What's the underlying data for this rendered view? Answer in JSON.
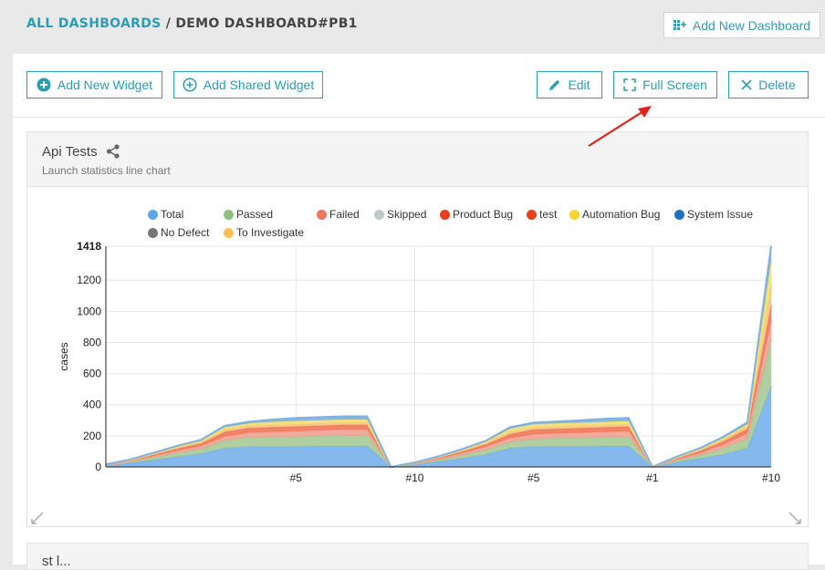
{
  "breadcrumb": {
    "all": "ALL DASHBOARDS",
    "sep": "/",
    "current": "DEMO DASHBOARD#PB1"
  },
  "header": {
    "add_dashboard": "Add New Dashboard"
  },
  "toolbar": {
    "add_widget": "Add New Widget",
    "add_shared": "Add Shared Widget",
    "edit": "Edit",
    "full_screen": "Full Screen",
    "delete": "Delete"
  },
  "widget": {
    "title": "Api Tests",
    "subtitle": "Launch statistics line chart"
  },
  "widget2": {
    "title": "st l..."
  },
  "colors": {
    "accent": "#2d9cb4",
    "arrow": "#e3221c"
  },
  "chart_data": {
    "type": "area",
    "ylabel": "cases",
    "y_max_label": "1418",
    "y_ticks": [
      "0",
      "200",
      "400",
      "600",
      "800",
      "1000",
      "1200"
    ],
    "x_ticks": [
      {
        "i": 8,
        "label": "#5"
      },
      {
        "i": 13,
        "label": "#10"
      },
      {
        "i": 18,
        "label": "#5"
      },
      {
        "i": 23,
        "label": "#1"
      },
      {
        "i": 28,
        "label": "#10"
      }
    ],
    "ylim": [
      0,
      1418
    ],
    "n_points": 29,
    "legend": [
      {
        "name": "Total",
        "color": "#5da5e8"
      },
      {
        "name": "Passed",
        "color": "#8fbf7f"
      },
      {
        "name": "Failed",
        "color": "#ee7559"
      },
      {
        "name": "Skipped",
        "color": "#c0c7ca"
      },
      {
        "name": "Product Bug",
        "color": "#e8401c"
      },
      {
        "name": "test",
        "color": "#e8401c"
      },
      {
        "name": "Automation Bug",
        "color": "#f5d42c"
      },
      {
        "name": "System Issue",
        "color": "#1f72c0"
      },
      {
        "name": "No Defect",
        "color": "#777777"
      },
      {
        "name": "To Investigate",
        "color": "#fcbf57"
      }
    ],
    "stack_colors": [
      "#7bb3ec",
      "#a9cb98",
      "#f0a394",
      "#f07a5a",
      "#f5c888",
      "#f2df72",
      "#7fb2de",
      "#f8c07a"
    ],
    "series": [
      {
        "name": "Passed-area",
        "values": [
          8,
          25,
          45,
          65,
          85,
          120,
          130,
          130,
          130,
          135,
          135,
          135,
          0,
          15,
          35,
          55,
          80,
          120,
          130,
          130,
          130,
          135,
          135,
          0,
          30,
          55,
          80,
          120,
          520
        ]
      },
      {
        "name": "Failed-area",
        "values": [
          2,
          8,
          15,
          25,
          30,
          50,
          60,
          65,
          65,
          65,
          70,
          70,
          0,
          5,
          10,
          20,
          30,
          40,
          50,
          55,
          55,
          55,
          60,
          0,
          10,
          20,
          40,
          60,
          300
        ]
      },
      {
        "name": "Defect-area",
        "values": [
          2,
          5,
          10,
          15,
          20,
          25,
          30,
          30,
          35,
          35,
          35,
          35,
          0,
          3,
          8,
          15,
          20,
          25,
          30,
          30,
          35,
          35,
          35,
          0,
          8,
          15,
          25,
          35,
          120
        ]
      },
      {
        "name": "Bug-area",
        "values": [
          1,
          4,
          8,
          12,
          15,
          30,
          30,
          30,
          30,
          30,
          30,
          30,
          0,
          2,
          6,
          10,
          15,
          25,
          30,
          30,
          30,
          30,
          30,
          0,
          6,
          12,
          20,
          30,
          100
        ]
      },
      {
        "name": "Auto-area",
        "values": [
          1,
          2,
          5,
          8,
          10,
          15,
          15,
          15,
          15,
          15,
          15,
          15,
          0,
          2,
          4,
          6,
          10,
          15,
          15,
          15,
          15,
          15,
          15,
          0,
          4,
          8,
          12,
          15,
          130
        ]
      },
      {
        "name": "Sys-area",
        "values": [
          1,
          2,
          4,
          6,
          8,
          15,
          15,
          20,
          20,
          20,
          20,
          20,
          0,
          1,
          3,
          5,
          8,
          20,
          20,
          20,
          20,
          20,
          20,
          0,
          4,
          6,
          10,
          15,
          160
        ]
      },
      {
        "name": "Top-area",
        "values": [
          1,
          2,
          3,
          5,
          6,
          10,
          10,
          15,
          20,
          20,
          20,
          20,
          0,
          1,
          2,
          4,
          6,
          10,
          10,
          12,
          15,
          20,
          20,
          0,
          3,
          5,
          8,
          12,
          90
        ]
      }
    ]
  }
}
